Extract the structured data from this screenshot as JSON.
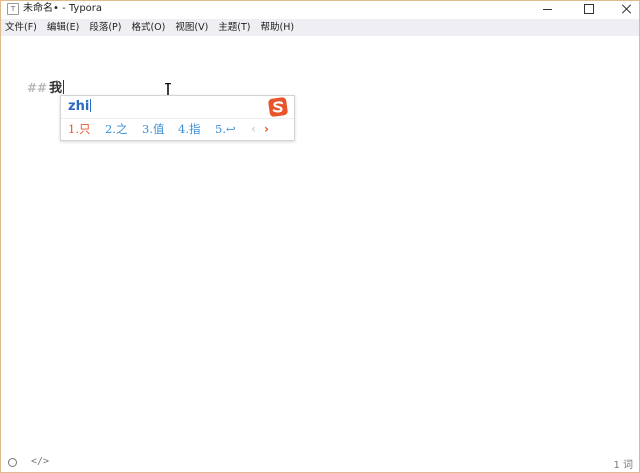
{
  "window": {
    "title": "未命名• - Typora",
    "app_icon": "T"
  },
  "menu": {
    "items": [
      "文件(F)",
      "编辑(E)",
      "段落(P)",
      "格式(O)",
      "视图(V)",
      "主题(T)",
      "帮助(H)"
    ]
  },
  "editor": {
    "heading_marker": "##",
    "heading_text": "我"
  },
  "ime": {
    "pinyin": "zhi",
    "candidates": [
      "1.只",
      "2.之",
      "3.值",
      "4.指",
      "5.↩"
    ],
    "prev": "‹",
    "next": "›"
  },
  "status": {
    "source_toggle": "</>",
    "word_count": "1 词"
  },
  "colors": {
    "accent_orange": "#e8552b",
    "candidate_blue": "#3b8fd8",
    "pinyin_blue": "#2a6bc0",
    "menubar_bg": "#efeef2",
    "window_border": "#e1b98a"
  }
}
